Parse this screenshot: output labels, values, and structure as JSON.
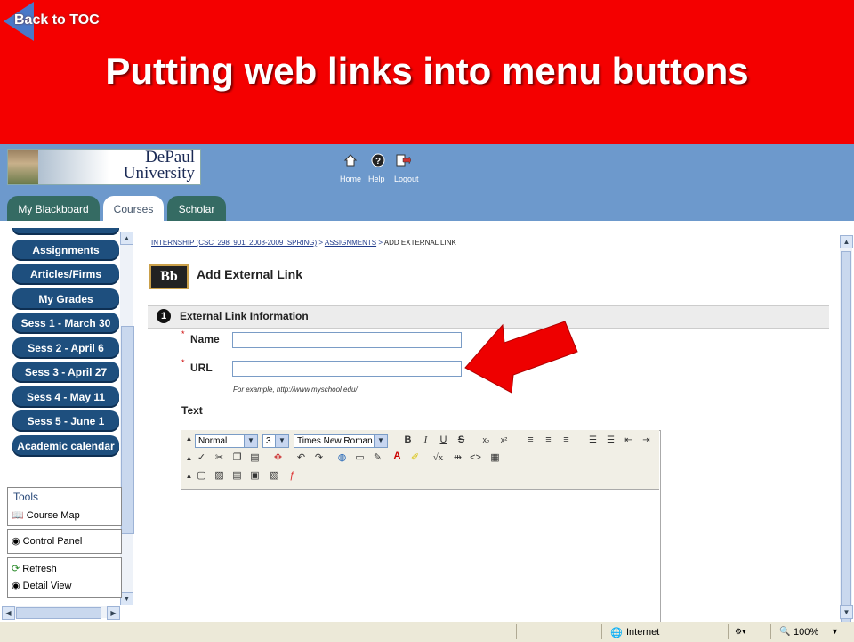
{
  "slide": {
    "back_link": "Back to TOC",
    "title": "Putting web links into menu buttons",
    "colors": {
      "header_red": "#f40000",
      "arrow_red": "#ee0000"
    }
  },
  "banner": {
    "logo_line1": "DePaul",
    "logo_line2": "University",
    "nav": [
      {
        "label": "Home",
        "icon": "home-icon"
      },
      {
        "label": "Help",
        "icon": "help-icon"
      },
      {
        "label": "Logout",
        "icon": "logout-icon"
      }
    ],
    "tabs": [
      "My Blackboard",
      "Courses",
      "Scholar"
    ],
    "active_tab": "Courses"
  },
  "sidebar": {
    "buttons": [
      "Assignments",
      "Articles/Firms",
      "My Grades",
      "Sess 1 - March 30",
      "Sess 2 - April 6",
      "Sess 3 - April 27",
      "Sess 4 - May 11",
      "Sess 5 - June 1",
      "Academic calendar"
    ],
    "tools_heading": "Tools",
    "course_map": "Course Map",
    "control_panel": "Control Panel",
    "refresh": "Refresh",
    "detail_view": "Detail View"
  },
  "main": {
    "breadcrumb": {
      "course": "INTERNSHIP (CSC_298_901_2008-2009_SPRING)",
      "sep1": ">",
      "assignments": "ASSIGNMENTS",
      "sep2": ">",
      "current": "ADD EXTERNAL LINK"
    },
    "bb_logo": "Bb",
    "heading": "Add External Link",
    "section_number": "1",
    "section_title": "External Link Information",
    "required_mark": "*",
    "name_label": "Name",
    "name_value": "",
    "url_label": "URL",
    "url_value": "",
    "url_hint": "For example, http://www.myschool.edu/",
    "text_label": "Text",
    "editor": {
      "style_select": "Normal",
      "size_select": "3",
      "font_select": "Times New Roman"
    }
  },
  "status": {
    "zone": "Internet",
    "zoom": "100%"
  }
}
